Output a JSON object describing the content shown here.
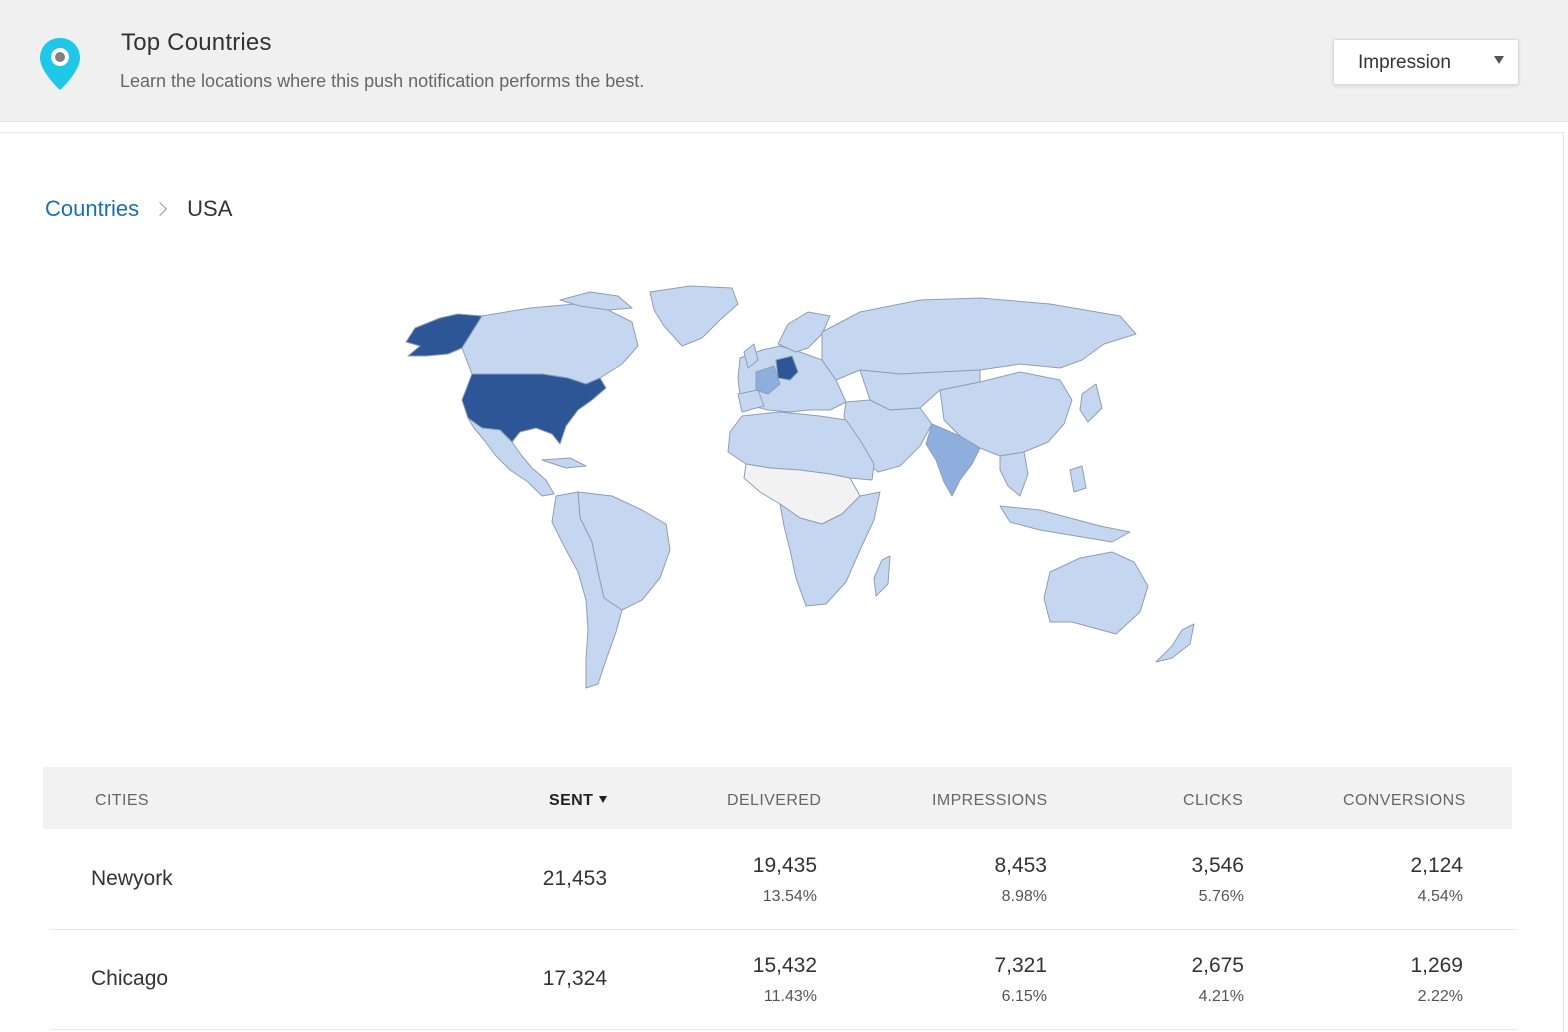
{
  "header": {
    "title": "Top Countries",
    "subtitle": "Learn the locations where this push notification performs the best.",
    "metric_select": {
      "selected": "Impression"
    },
    "pin_color": "#1ec8e6"
  },
  "breadcrumb": {
    "root": "Countries",
    "current": "USA"
  },
  "map": {
    "colors": {
      "highlight": "#2d5696",
      "medium": "#8eafdd",
      "low": "#c5d7f0",
      "none": "#f2f2f2",
      "border": "#8f9db5"
    },
    "highlighted_countries": [
      "USA",
      "Germany"
    ]
  },
  "table": {
    "columns": [
      "CITIES",
      "SENT",
      "DELIVERED",
      "IMPRESSIONS",
      "CLICKS",
      "CONVERSIONS"
    ],
    "rows": [
      {
        "city": "Newyork",
        "sent": "21,453",
        "delivered": "19,435",
        "delivered_pct": "13.54%",
        "impressions": "8,453",
        "impressions_pct": "8.98%",
        "clicks": "3,546",
        "clicks_pct": "5.76%",
        "conversions": "2,124",
        "conversions_pct": "4.54%"
      },
      {
        "city": "Chicago",
        "sent": "17,324",
        "delivered": "15,432",
        "delivered_pct": "11.43%",
        "impressions": "7,321",
        "impressions_pct": "6.15%",
        "clicks": "2,675",
        "clicks_pct": "4.21%",
        "conversions": "1,269",
        "conversions_pct": "2.22%"
      }
    ]
  }
}
